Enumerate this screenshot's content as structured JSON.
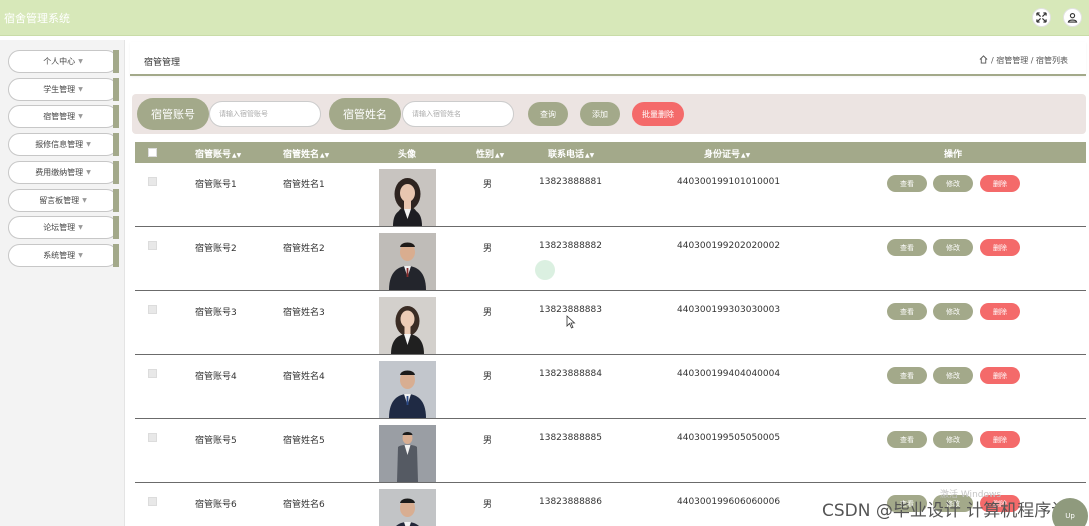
{
  "header": {
    "app_title": "宿舍管理系统"
  },
  "sidebar": {
    "items": [
      {
        "label": "个人中心"
      },
      {
        "label": "学生管理"
      },
      {
        "label": "宿管管理"
      },
      {
        "label": "报修信息管理"
      },
      {
        "label": "费用缴纳管理"
      },
      {
        "label": "留言板管理"
      },
      {
        "label": "论坛管理"
      },
      {
        "label": "系统管理"
      }
    ]
  },
  "breadcrumb": {
    "title": "宿管管理",
    "path": "/ 宿管管理 / 宿管列表"
  },
  "search": {
    "account_label": "宿管账号",
    "account_placeholder": "请输入宿管账号",
    "name_label": "宿管姓名",
    "name_placeholder": "请输入宿管姓名",
    "query_button": "查询",
    "add_button": "添加",
    "batch_delete_button": "批量删除"
  },
  "table": {
    "headers": {
      "account": "宿管账号",
      "name": "宿管姓名",
      "photo": "头像",
      "gender": "性别",
      "phone": "联系电话",
      "id_number": "身份证号",
      "actions": "操作"
    },
    "action_labels": {
      "view": "查看",
      "edit": "修改",
      "delete": "删除"
    },
    "rows": [
      {
        "account": "宿管账号1",
        "name": "宿管姓名1",
        "gender": "男",
        "phone": "13823888881",
        "id_number": "440300199101010001"
      },
      {
        "account": "宿管账号2",
        "name": "宿管姓名2",
        "gender": "男",
        "phone": "13823888882",
        "id_number": "440300199202020002"
      },
      {
        "account": "宿管账号3",
        "name": "宿管姓名3",
        "gender": "男",
        "phone": "13823888883",
        "id_number": "440300199303030003"
      },
      {
        "account": "宿管账号4",
        "name": "宿管姓名4",
        "gender": "男",
        "phone": "13823888884",
        "id_number": "440300199404040004"
      },
      {
        "account": "宿管账号5",
        "name": "宿管姓名5",
        "gender": "男",
        "phone": "13823888885",
        "id_number": "440300199505050005"
      },
      {
        "account": "宿管账号6",
        "name": "宿管姓名6",
        "gender": "男",
        "phone": "13823888886",
        "id_number": "440300199606060006"
      }
    ]
  },
  "overlay": {
    "watermark": "CSDN @毕业设计 计算机程序设计",
    "activate_windows": "激活 Windows",
    "go_top": "Up"
  },
  "colors": {
    "header_bg": "#d7e8b9",
    "accent_olive": "#a3a98a",
    "danger_red": "#f46a6a",
    "search_bg": "#ece4e2"
  }
}
